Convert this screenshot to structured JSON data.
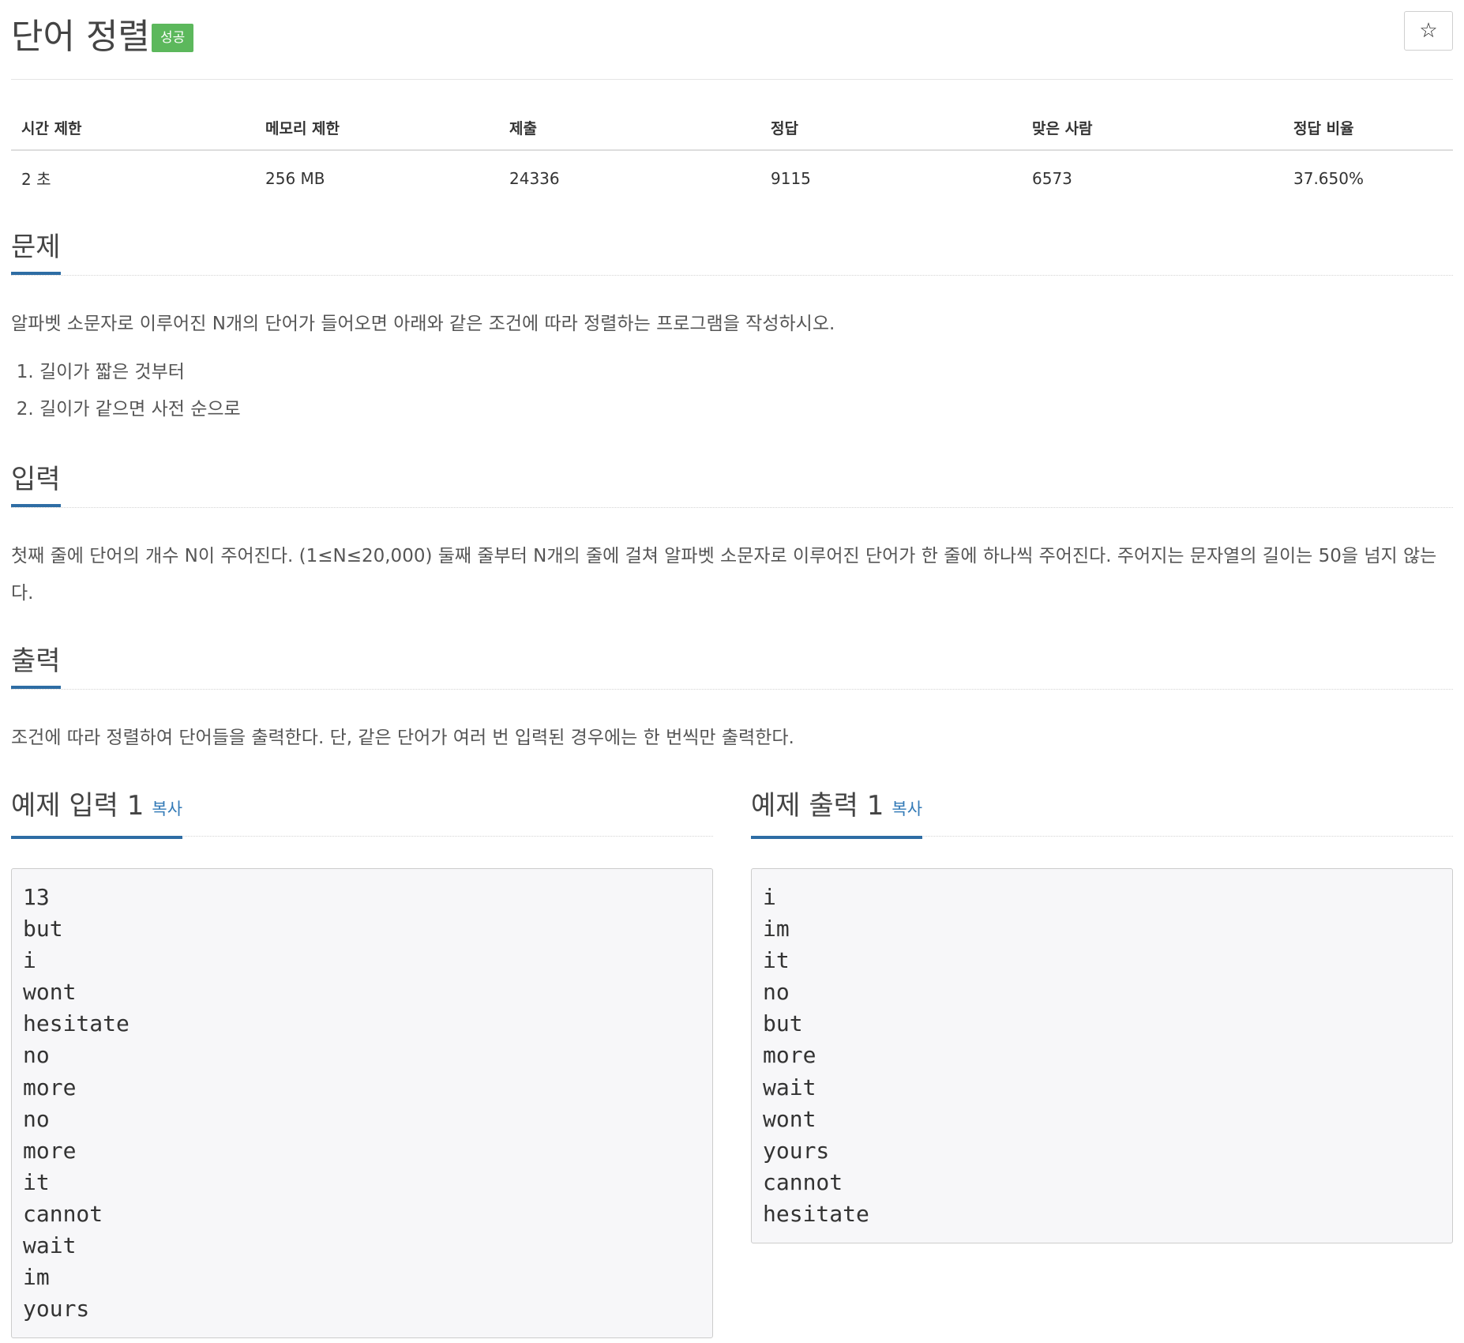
{
  "problem": {
    "title": "단어 정렬",
    "status_badge": "성공",
    "star_icon": "☆"
  },
  "stats": {
    "headers": [
      "시간 제한",
      "메모리 제한",
      "제출",
      "정답",
      "맞은 사람",
      "정답 비율"
    ],
    "values": [
      "2 초",
      "256 MB",
      "24336",
      "9115",
      "6573",
      "37.650%"
    ]
  },
  "sections": {
    "description": {
      "title": "문제",
      "text": "알파벳 소문자로 이루어진 N개의 단어가 들어오면 아래와 같은 조건에 따라 정렬하는 프로그램을 작성하시오.",
      "list": [
        "길이가 짧은 것부터",
        "길이가 같으면 사전 순으로"
      ]
    },
    "input": {
      "title": "입력",
      "text": "첫째 줄에 단어의 개수 N이 주어진다. (1≤N≤20,000) 둘째 줄부터 N개의 줄에 걸쳐 알파벳 소문자로 이루어진 단어가 한 줄에 하나씩 주어진다. 주어지는 문자열의 길이는 50을 넘지 않는다."
    },
    "output": {
      "title": "출력",
      "text": "조건에 따라 정렬하여 단어들을 출력한다. 단, 같은 단어가 여러 번 입력된 경우에는 한 번씩만 출력한다."
    }
  },
  "samples": {
    "input": {
      "title": "예제 입력 1",
      "copy_label": "복사",
      "content": "13\nbut\ni\nwont\nhesitate\nno\nmore\nno\nmore\nit\ncannot\nwait\nim\nyours"
    },
    "output": {
      "title": "예제 출력 1",
      "copy_label": "복사",
      "content": "i\nim\nit\nno\nbut\nmore\nwait\nwont\nyours\ncannot\nhesitate"
    }
  },
  "colors": {
    "badge": "#5cb85c",
    "accent": "#2e6da4",
    "link": "#337ab7",
    "code_bg": "#f7f7f9"
  }
}
